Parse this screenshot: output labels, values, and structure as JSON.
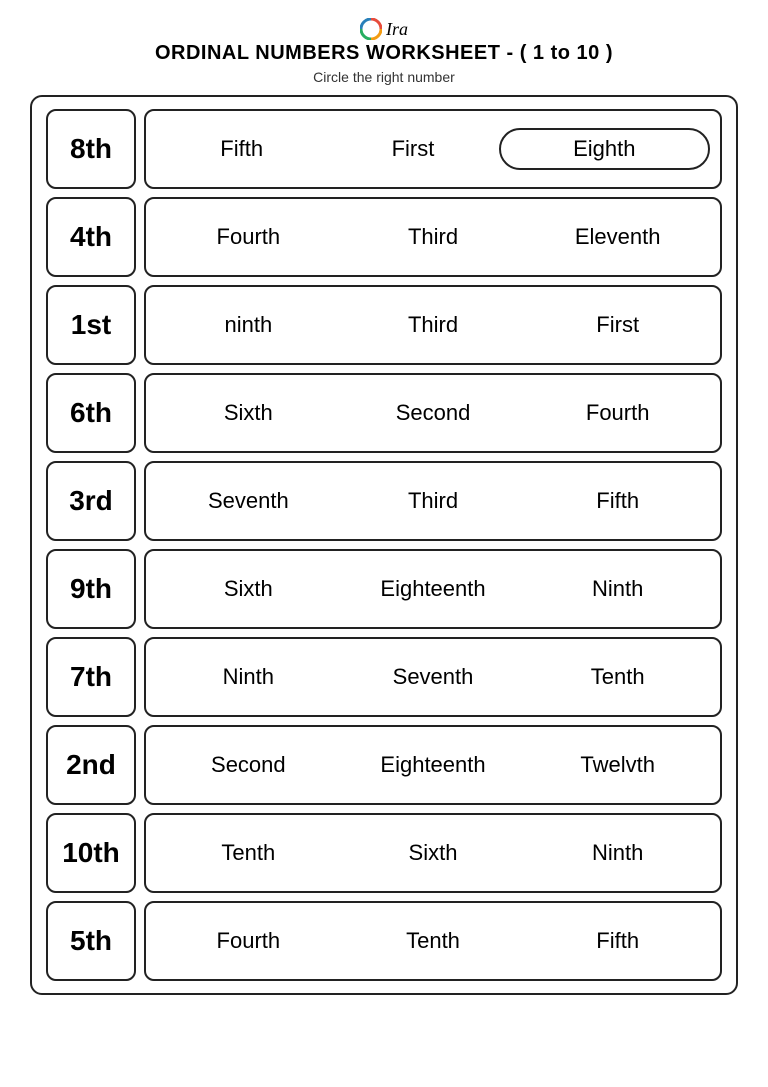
{
  "header": {
    "logo_text": "Ira",
    "title": "ORDINAL NUMBERS WORKSHEET - ( 1 to 10 )",
    "subtitle": "Circle the right number"
  },
  "rows": [
    {
      "number": "8th",
      "options": [
        {
          "text": "Fifth",
          "circled": false
        },
        {
          "text": "First",
          "circled": false
        },
        {
          "text": "Eighth",
          "circled": true
        }
      ]
    },
    {
      "number": "4th",
      "options": [
        {
          "text": "Fourth",
          "circled": false
        },
        {
          "text": "Third",
          "circled": false
        },
        {
          "text": "Eleventh",
          "circled": false
        }
      ]
    },
    {
      "number": "1st",
      "options": [
        {
          "text": "ninth",
          "circled": false
        },
        {
          "text": "Third",
          "circled": false
        },
        {
          "text": "First",
          "circled": false
        }
      ]
    },
    {
      "number": "6th",
      "options": [
        {
          "text": "Sixth",
          "circled": false
        },
        {
          "text": "Second",
          "circled": false
        },
        {
          "text": "Fourth",
          "circled": false
        }
      ]
    },
    {
      "number": "3rd",
      "options": [
        {
          "text": "Seventh",
          "circled": false
        },
        {
          "text": "Third",
          "circled": false
        },
        {
          "text": "Fifth",
          "circled": false
        }
      ]
    },
    {
      "number": "9th",
      "options": [
        {
          "text": "Sixth",
          "circled": false
        },
        {
          "text": "Eighteenth",
          "circled": false
        },
        {
          "text": "Ninth",
          "circled": false
        }
      ]
    },
    {
      "number": "7th",
      "options": [
        {
          "text": "Ninth",
          "circled": false
        },
        {
          "text": "Seventh",
          "circled": false
        },
        {
          "text": "Tenth",
          "circled": false
        }
      ]
    },
    {
      "number": "2nd",
      "options": [
        {
          "text": "Second",
          "circled": false
        },
        {
          "text": "Eighteenth",
          "circled": false
        },
        {
          "text": "Twelvth",
          "circled": false
        }
      ]
    },
    {
      "number": "10th",
      "options": [
        {
          "text": "Tenth",
          "circled": false
        },
        {
          "text": "Sixth",
          "circled": false
        },
        {
          "text": "Ninth",
          "circled": false
        }
      ]
    },
    {
      "number": "5th",
      "options": [
        {
          "text": "Fourth",
          "circled": false
        },
        {
          "text": "Tenth",
          "circled": false
        },
        {
          "text": "Fifth",
          "circled": false
        }
      ]
    }
  ]
}
